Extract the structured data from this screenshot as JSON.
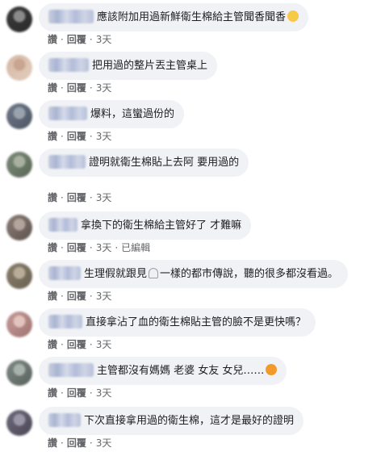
{
  "actions": {
    "like": "讚",
    "reply": "回覆",
    "edited": "已編輯",
    "separator": "·"
  },
  "comments": [
    {
      "text": "應該附加用過新鮮衛生棉給主管聞香聞香",
      "time": "3天",
      "emoji": "laughing-face-icon",
      "avatar_colors": [
        "#3b3b3b",
        "#8a8a8a",
        "#2a2a2a"
      ]
    },
    {
      "text": "把用過的整片丟主管桌上",
      "time": "3天",
      "avatar_colors": [
        "#d4b7a4",
        "#c9a48f",
        "#e3cdbd"
      ]
    },
    {
      "text": "爆料，這蠻過份的",
      "time": "3天",
      "avatar_colors": [
        "#6f7a8a",
        "#9aa3ad",
        "#4d5563"
      ]
    },
    {
      "text": "證明就衛生棉貼上去阿\n要用過的",
      "time": "3天",
      "avatar_colors": [
        "#7c8c7a",
        "#a8b0a0",
        "#5a6655"
      ]
    },
    {
      "text": "拿換下的衛生棉給主管好了 才難嘛",
      "time": "3天",
      "edited": true,
      "avatar_colors": [
        "#8c7d76",
        "#b3a49c",
        "#5e534e"
      ]
    },
    {
      "text_before": "生理假就跟見",
      "text_after": "一樣的都市傳說，聽的很多都沒看過。",
      "time": "3天",
      "avatar_colors": [
        "#8a7f6c",
        "#b8ad98",
        "#6a6152"
      ]
    },
    {
      "text": "直接拿沾了血的衛生棉貼主管的臉不是更快嗎？",
      "time": "3天",
      "avatar_colors": [
        "#c79a9a",
        "#e3c3bd",
        "#9e7470"
      ]
    },
    {
      "text": "主管都沒有媽媽 老婆 女友 女兒……",
      "time": "3天",
      "emoji": "sad-face-icon",
      "avatar_colors": [
        "#7f8a84",
        "#a7b2ad",
        "#59615d"
      ]
    },
    {
      "text": "下次直接拿用過的衛生棉，這才是最好的證明",
      "time": "3天",
      "avatar_colors": [
        "#6e6a7a",
        "#9c97a8",
        "#4b4757"
      ]
    }
  ]
}
